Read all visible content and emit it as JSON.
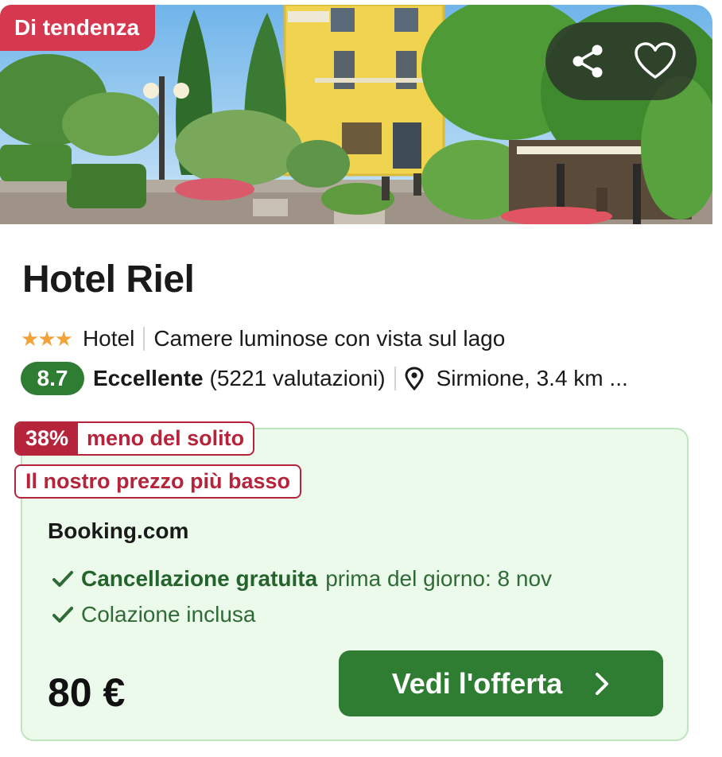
{
  "hotel": {
    "badge": "Di tendenza",
    "name": "Hotel Riel",
    "stars": 3,
    "type": "Hotel",
    "highlight": "Camere luminose con vista sul lago",
    "score": "8.7",
    "rating_word": "Eccellente",
    "reviews": "(5221 valutazioni)",
    "location": "Sirmione, 3.4 km ..."
  },
  "actions": {
    "share_icon": "share-icon",
    "favorite_icon": "heart-icon"
  },
  "offer": {
    "discount_pct": "38%",
    "discount_text": "meno del solito",
    "lowest_label": "Il nostro prezzo più basso",
    "provider": "Booking.com",
    "features": [
      {
        "strong": "Cancellazione gratuita",
        "text": "prima del giorno: 8 nov"
      },
      {
        "strong": "",
        "text": "Colazione inclusa"
      }
    ],
    "price": "80 €",
    "cta_label": "Vedi l'offerta"
  },
  "colors": {
    "badge": "#d6384f",
    "score": "#2e7d32",
    "discount": "#b5243a",
    "offer_bg": "#ecfaec",
    "cta": "#2e7d32",
    "stars": "#f2a33a"
  }
}
